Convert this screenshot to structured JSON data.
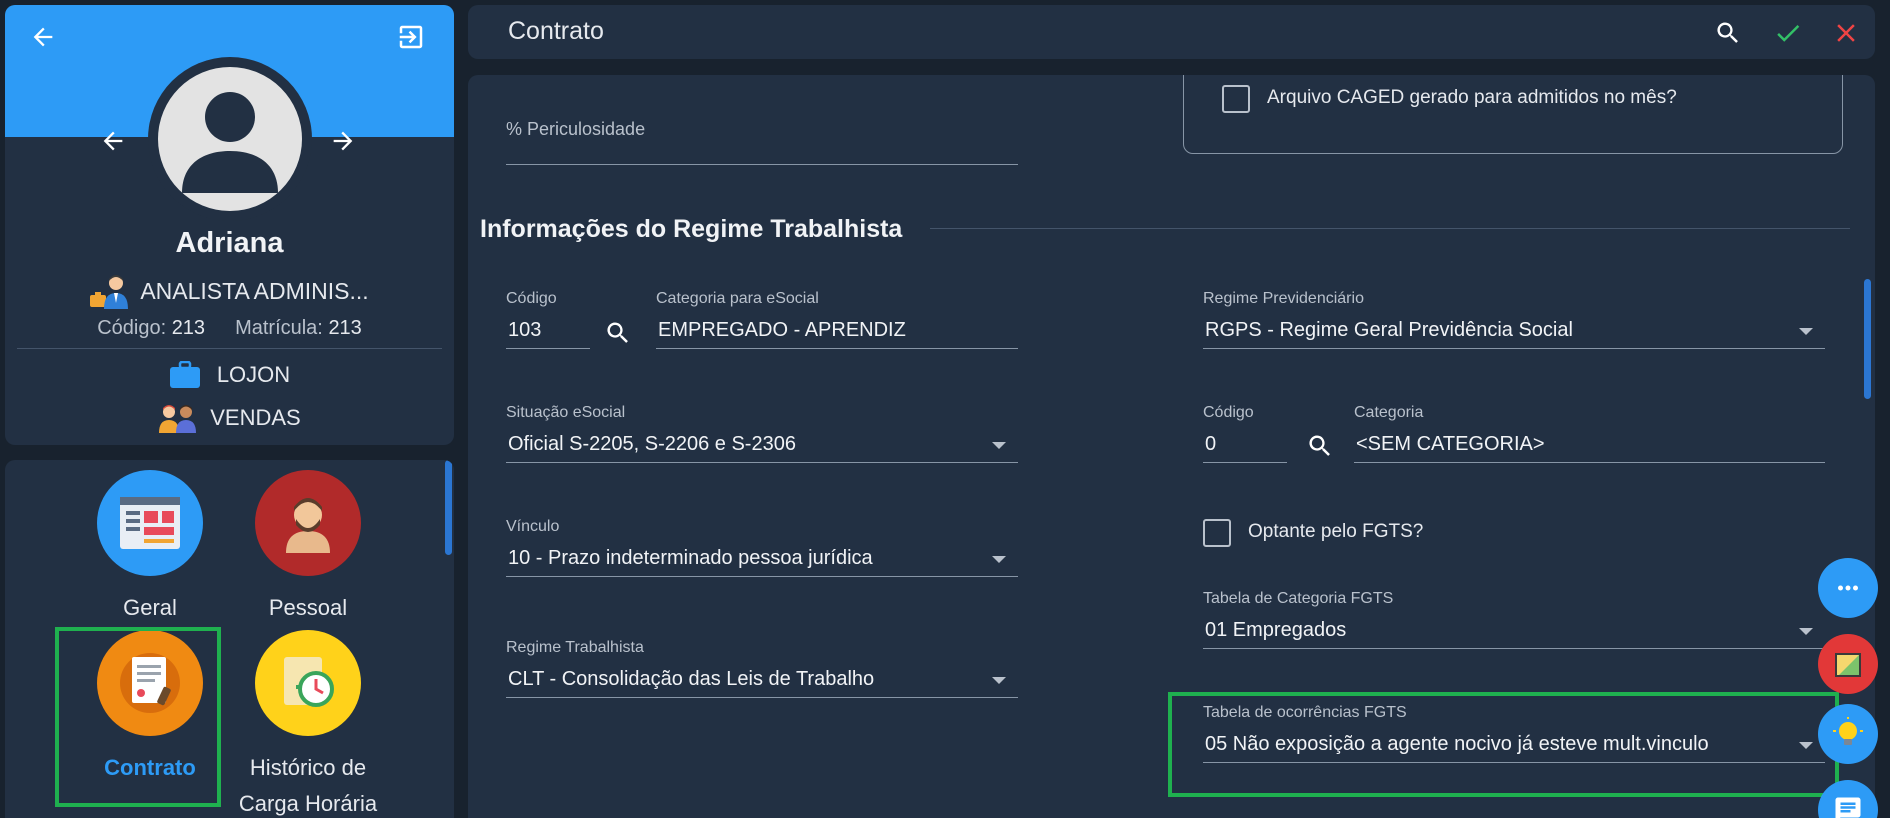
{
  "profile": {
    "name": "Adriana",
    "role": "ANALISTA ADMINIS...",
    "codigo_label": "Código:",
    "codigo_value": "213",
    "matricula_label": "Matrícula:",
    "matricula_value": "213",
    "store": "LOJON",
    "department": "VENDAS"
  },
  "menu": {
    "items": [
      {
        "label": "Geral",
        "icon": "webpage-icon"
      },
      {
        "label": "Pessoal",
        "icon": "person-icon"
      },
      {
        "label": "Contrato",
        "icon": "contract-icon",
        "active": true
      },
      {
        "label": "Histórico de Carga Horária",
        "icon": "clock-history-icon"
      }
    ]
  },
  "topbar": {
    "title": "Contrato"
  },
  "form": {
    "periculosidade_label": "% Periculosidade",
    "periculosidade_value": "",
    "caged_label": "Arquivo CAGED gerado para admitidos no mês?",
    "section_title": "Informações do Regime Trabalhista",
    "codigo_label": "Código",
    "codigo_value": "103",
    "categoria_esocial_label": "Categoria para eSocial",
    "categoria_esocial_value": "EMPREGADO - APRENDIZ",
    "regime_prev_label": "Regime Previdenciário",
    "regime_prev_value": "RGPS - Regime Geral Previdência Social",
    "situacao_label": "Situação eSocial",
    "situacao_value": "Oficial S-2205, S-2206 e S-2306",
    "codigo2_label": "Código",
    "codigo2_value": "0",
    "categoria_label": "Categoria",
    "categoria_value": "<SEM CATEGORIA>",
    "vinculo_label": "Vínculo",
    "vinculo_value": "10 - Prazo indeterminado pessoa jurídica",
    "optante_label": "Optante pelo FGTS?",
    "tabela_cat_fgts_label": "Tabela de Categoria FGTS",
    "tabela_cat_fgts_value": "01 Empregados",
    "regime_trab_label": "Regime Trabalhista",
    "regime_trab_value": "CLT - Consolidação das Leis de Trabalho",
    "tabela_ocorr_label": "Tabela de ocorrências FGTS",
    "tabela_ocorr_value": "05 Não exposição a agente nocivo já esteve mult.vinculo"
  },
  "colors": {
    "accent": "#2d9bf6",
    "highlight": "#1fb04f",
    "panel": "#223043",
    "background": "#18222e"
  }
}
